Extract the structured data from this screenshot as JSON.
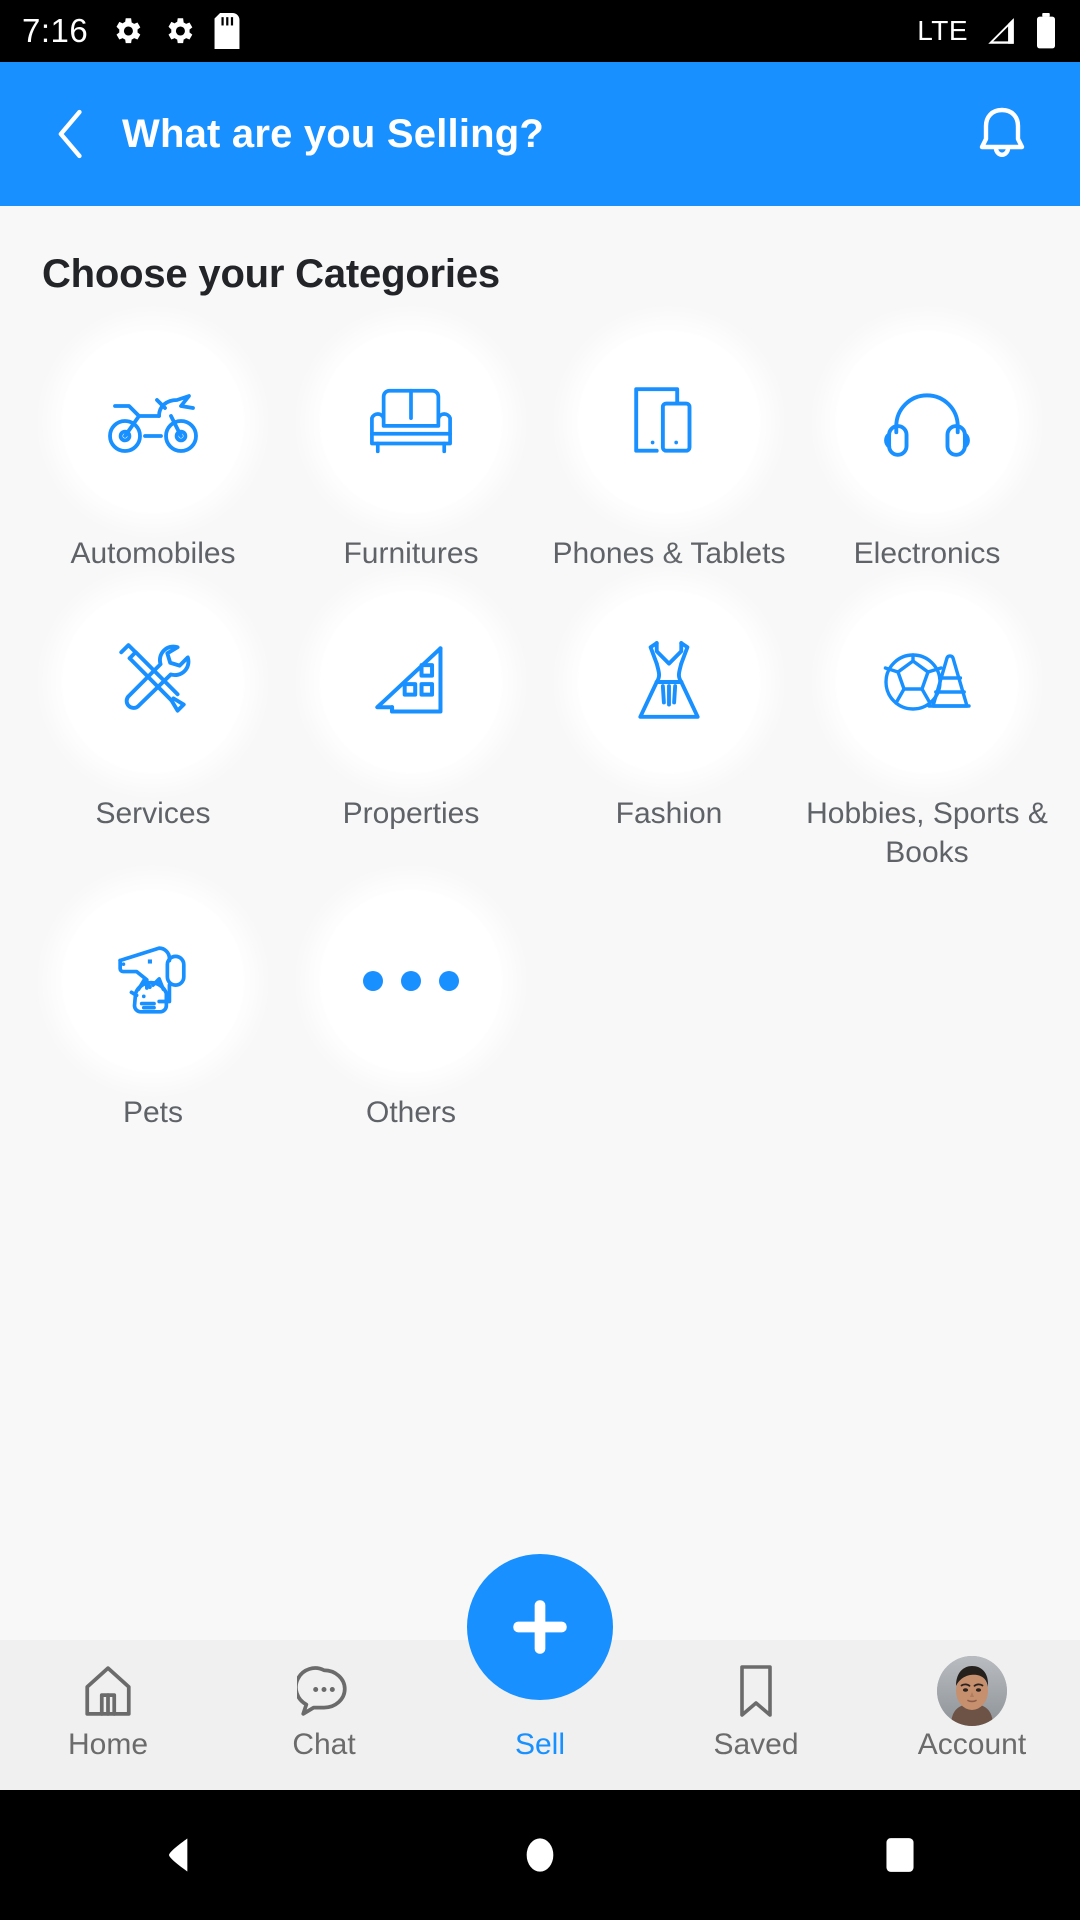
{
  "status_bar": {
    "time": "7:16",
    "network": "LTE",
    "icons": [
      "gear-icon",
      "gear-icon",
      "sd-card-icon",
      "signal-icon",
      "battery-icon"
    ]
  },
  "app_bar": {
    "back_icon": "chevron-left-icon",
    "title": "What are you Selling?",
    "notification_icon": "bell-icon",
    "background_color": "#1890FF"
  },
  "main": {
    "section_title": "Choose your Categories",
    "categories": [
      {
        "label": "Automobiles",
        "icon": "motorcycle-icon"
      },
      {
        "label": "Furnitures",
        "icon": "sofa-icon"
      },
      {
        "label": "Phones & Tablets",
        "icon": "phone-tablet-icon"
      },
      {
        "label": "Electronics",
        "icon": "headphones-icon"
      },
      {
        "label": "Services",
        "icon": "tools-icon"
      },
      {
        "label": "Properties",
        "icon": "house-icon"
      },
      {
        "label": "Fashion",
        "icon": "dress-icon"
      },
      {
        "label": "Hobbies, Sports & Books",
        "icon": "ball-cone-icon"
      },
      {
        "label": "Pets",
        "icon": "dog-cat-icon"
      },
      {
        "label": "Others",
        "icon": "ellipsis-icon"
      }
    ],
    "accent_color": "#1890FF",
    "label_color": "#5F6368",
    "background_color": "#F8F8F8"
  },
  "bottom_nav": {
    "items": [
      {
        "label": "Home",
        "icon": "house-outline-icon",
        "active": false
      },
      {
        "label": "Chat",
        "icon": "chat-bubble-icon",
        "active": false
      },
      {
        "label": "Sell",
        "icon": "plus-icon",
        "active": true
      },
      {
        "label": "Saved",
        "icon": "bookmark-icon",
        "active": false
      },
      {
        "label": "Account",
        "icon": "avatar-icon",
        "active": false
      }
    ],
    "fab_icon": "plus-icon",
    "active_color": "#1890FF",
    "background_color": "#F0F0F0"
  },
  "android_nav": {
    "back": "triangle-back-icon",
    "home": "circle-home-icon",
    "recents": "square-recents-icon"
  }
}
